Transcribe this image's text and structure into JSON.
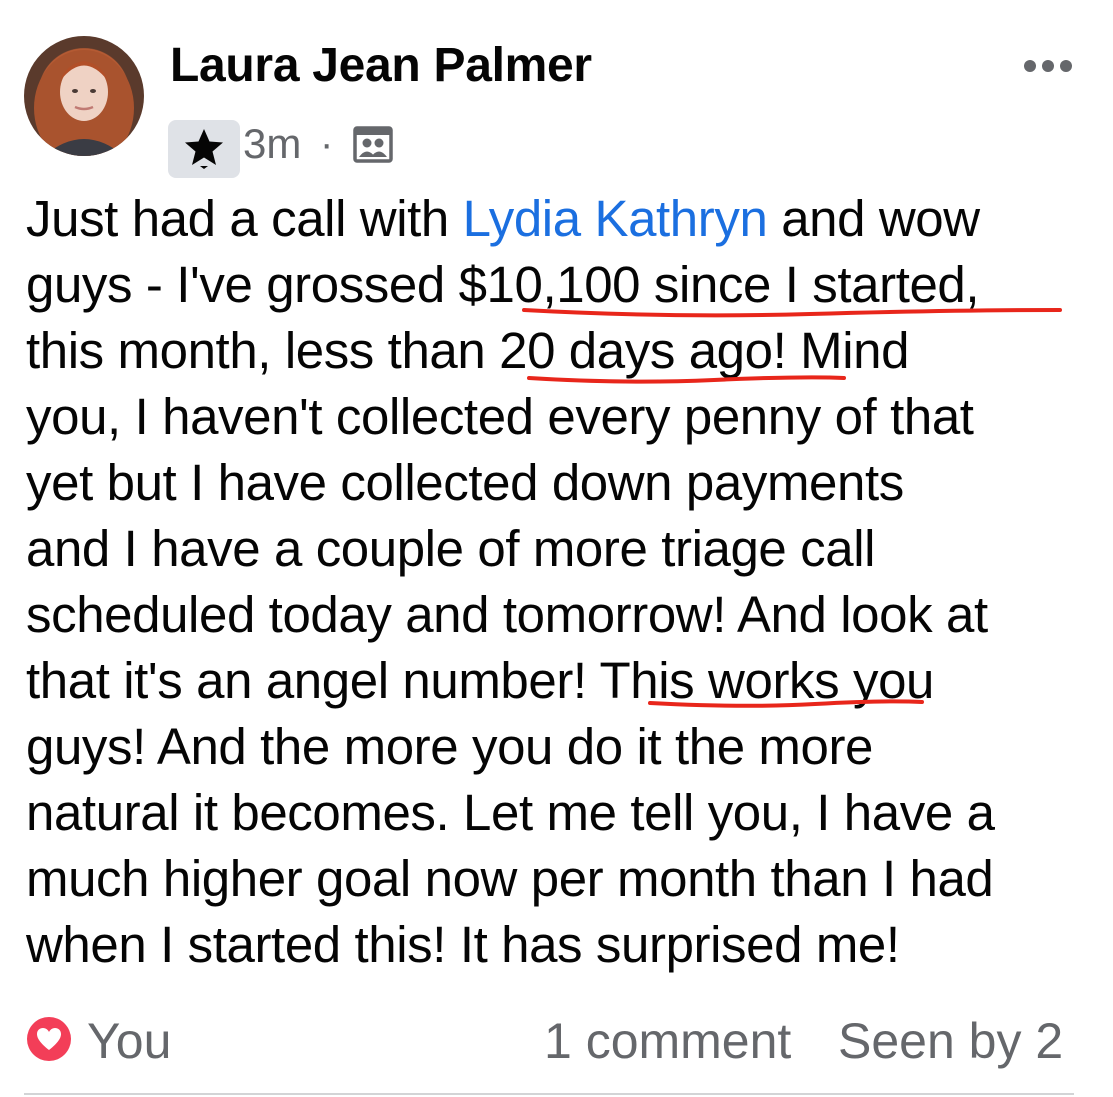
{
  "post": {
    "author": "Laura Jean Palmer",
    "time": "3m",
    "separator": "·",
    "audience_icon": "group-icon",
    "badge_icon": "star-icon",
    "more_icon": "more-horizontal-icon",
    "mention": "Lydia Kathryn",
    "lines": {
      "l1_before": "Just had a call with ",
      "l1_after": " and wow",
      "l2": "guys - I've grossed $10,100 since I started,",
      "l3": "this month, less than 20 days ago! Mind",
      "l4": "you, I haven't collected every penny of that",
      "l5": "yet but I have collected down payments",
      "l6": "and I have a couple of more triage call",
      "l7": "scheduled today and tomorrow! And look at",
      "l8": "that it's an angel number! This works you",
      "l9": "guys! And the more you do it the more",
      "l10": "natural it becomes. Let me tell you, I have a",
      "l11": "much higher goal now per month than I had",
      "l12": "when I started this! It has surprised me!"
    }
  },
  "footer": {
    "reaction_icon": "love-reaction-icon",
    "reactor": "You",
    "comments": "1 comment",
    "seen": "Seen by 2"
  },
  "colors": {
    "link": "#1b6fe0",
    "secondary_text": "#65676b",
    "annotation": "#e8261b",
    "reaction_red": "#f33e58"
  }
}
